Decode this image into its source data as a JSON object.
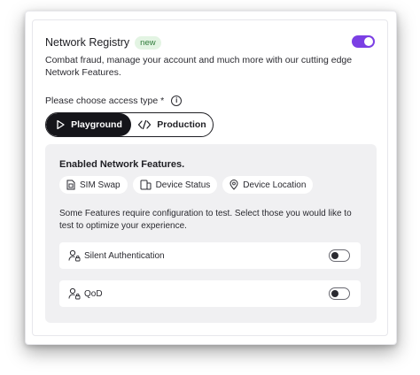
{
  "header": {
    "title": "Network Registry",
    "badge": "new",
    "toggle_on": true,
    "accent_color": "#7b3fe4"
  },
  "description": "Combat fraud, manage your account and much more with our cutting edge Network Features.",
  "access": {
    "label": "Please choose access type *",
    "info_icon": "info-icon",
    "options": [
      {
        "label": "Playground",
        "icon": "play-icon",
        "selected": true
      },
      {
        "label": "Production",
        "icon": "code-icon",
        "selected": false
      }
    ]
  },
  "panel": {
    "title": "Enabled Network Features.",
    "chips": [
      {
        "label": "SIM Swap",
        "icon": "sim-card-icon"
      },
      {
        "label": "Device Status",
        "icon": "devices-icon"
      },
      {
        "label": "Device Location",
        "icon": "location-pin-icon"
      }
    ],
    "config_text": "Some Features require configuration to test. Select those you would like to test to optimize your experience.",
    "features": [
      {
        "label": "Silent Authentication",
        "icon": "user-lock-icon",
        "enabled": false
      },
      {
        "label": "QoD",
        "icon": "user-lock-icon",
        "enabled": false
      }
    ]
  }
}
